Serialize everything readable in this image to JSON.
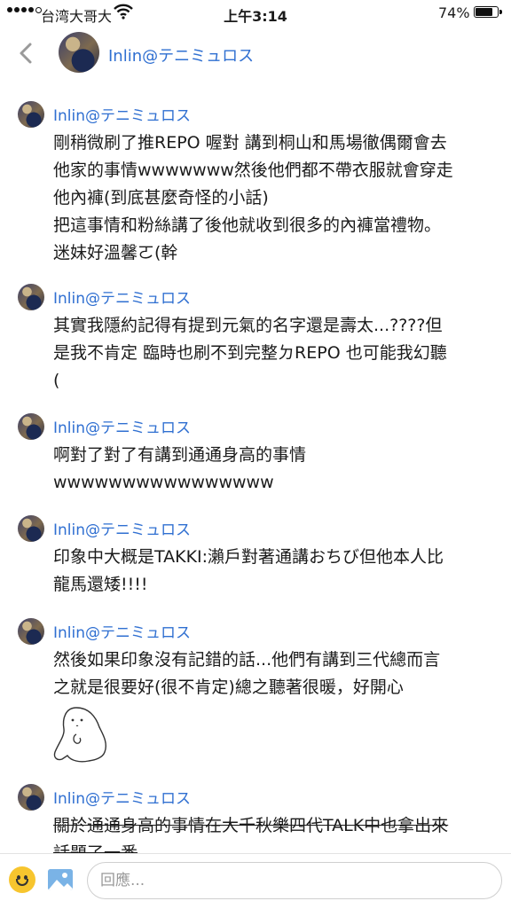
{
  "status_bar": {
    "carrier": "台湾大哥大",
    "time": "上午3:14",
    "battery_pct": "74%",
    "battery_level": 0.74
  },
  "header": {
    "title": "Inlin@テニミュロス"
  },
  "posts": [
    {
      "author": "Inlin@テニミュロス",
      "text": "剛稍微刷了推REPO 喔對 講到桐山和馬場徹偶爾會去\n他家的事情wwwwwww然後他們都不帶衣服就會穿走\n他內褲(到底甚麼奇怪的小話)\n把這事情和粉絲講了後他就收到很多的內褲當禮物。\n迷妹好溫馨ㄛ(幹"
    },
    {
      "author": "Inlin@テニミュロス",
      "text": "其實我隱約記得有提到元氣的名字還是壽太...????但\n是我不肯定 臨時也刷不到完整ㄉREPO 也可能我幻聽\n("
    },
    {
      "author": "Inlin@テニミュロス",
      "text": "啊對了對了有講到通通身高的事情\nwwwwwwwwwwwwwwww"
    },
    {
      "author": "Inlin@テニミュロス",
      "text": "印象中大概是TAKKI:瀨戶對著通講おちび但他本人比\n龍馬還矮!!!!"
    },
    {
      "author": "Inlin@テニミュロス",
      "text": "然後如果印象沒有記錯的話...他們有講到三代總而言\n之就是很要好(很不肯定)總之聽著很暖，好開心"
    },
    {
      "author": "Inlin@テニミュロス",
      "text": "關於通通身高的事情在大千秋樂四代TALK中也拿出來\n話題了一番"
    }
  ],
  "composer": {
    "placeholder": "回應..."
  },
  "icons": {
    "back": "chevron-left-icon",
    "emoji": "emoji-icon",
    "image": "image-icon",
    "wifi": "wifi-icon",
    "battery": "battery-icon"
  },
  "colors": {
    "author_blue": "#2f6fd1",
    "back_gray": "#9a9a9a",
    "emoji_yellow": "#f7c52e",
    "image_blue": "#7ab3e6"
  }
}
